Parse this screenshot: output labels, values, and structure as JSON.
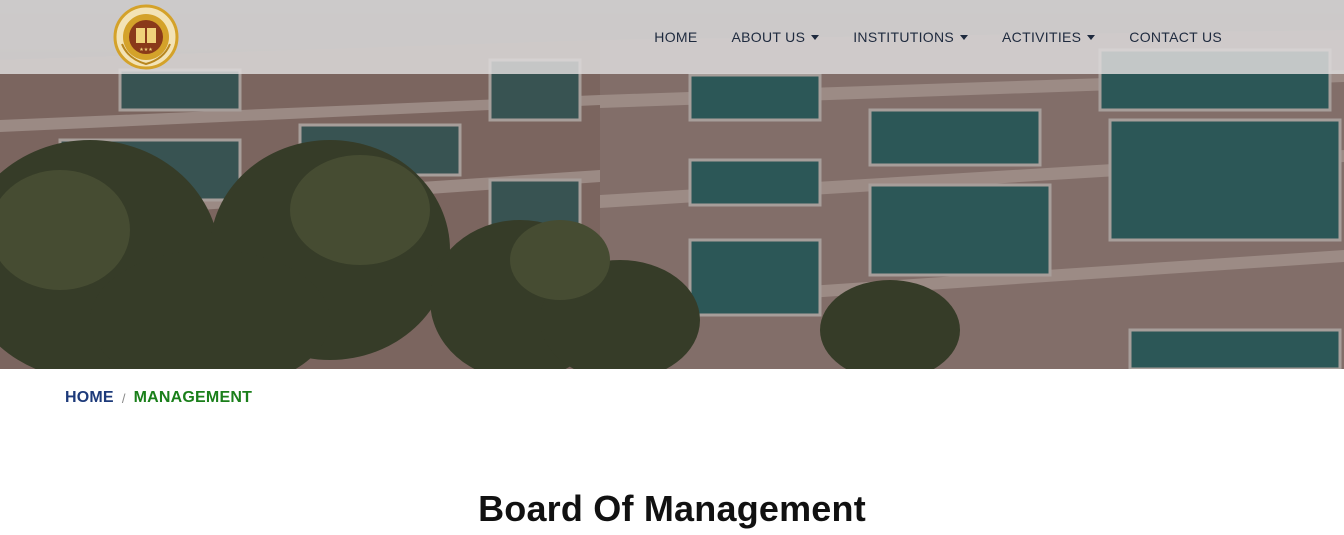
{
  "nav": {
    "items": [
      {
        "label": "HOME",
        "dropdown": false
      },
      {
        "label": "ABOUT US",
        "dropdown": true
      },
      {
        "label": "INSTITUTIONS",
        "dropdown": true
      },
      {
        "label": "ACTIVITIES",
        "dropdown": true
      },
      {
        "label": "CONTACT US",
        "dropdown": false
      }
    ]
  },
  "logo": {
    "icon": "trust-emblem-logo",
    "gold": "#d4a22a",
    "maroon": "#8a3a1a"
  },
  "hero": {
    "icon": "campus-building-photo"
  },
  "breadcrumb": {
    "home": "HOME",
    "separator": "/",
    "current": "MANAGEMENT"
  },
  "page": {
    "title": "Board Of Management"
  },
  "colors": {
    "breadcrumb_home": "#1d3a7a",
    "breadcrumb_current": "#1a7f1a",
    "nav_text": "#1e2a3e"
  }
}
